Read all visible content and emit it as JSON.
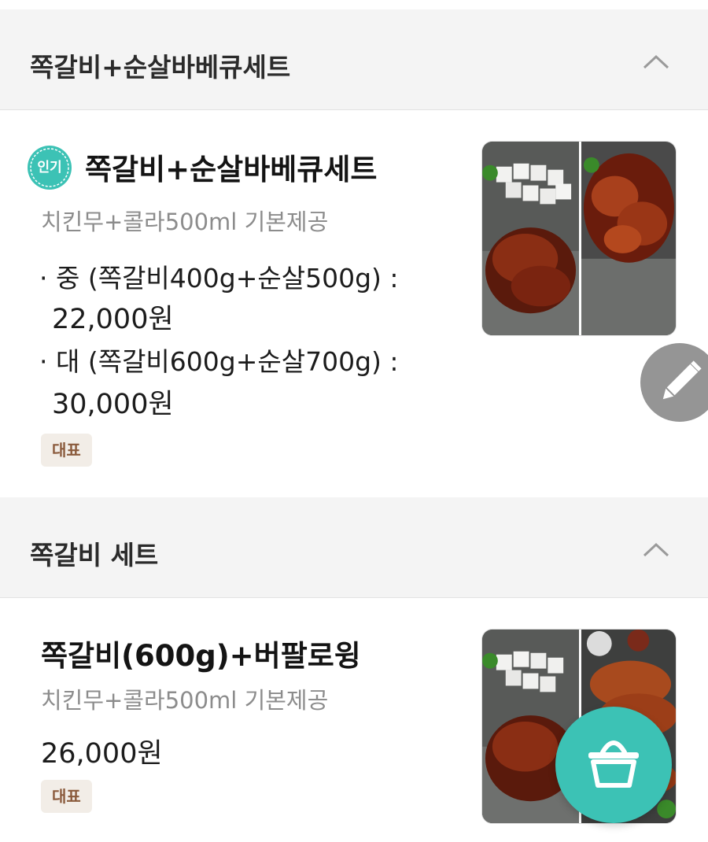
{
  "sections": [
    {
      "title": "쪽갈비+순살바베큐세트",
      "item": {
        "badge": "인기",
        "name": "쪽갈비+순살바베큐세트",
        "desc": "치킨무+콜라500ml 기본제공",
        "options": [
          {
            "label": "· 중 (쪽갈비400g+순살500g) :",
            "price": "22,000원"
          },
          {
            "label": "· 대 (쪽갈비600g+순살700g) :",
            "price": "30,000원"
          }
        ],
        "tag": "대표"
      }
    },
    {
      "title": "쪽갈비 세트",
      "item": {
        "name": "쪽갈비(600g)+버팔로윙",
        "desc": "치킨무+콜라500ml 기본제공",
        "price": "26,000원",
        "tag": "대표"
      }
    }
  ],
  "icons": {
    "collapse": "chevron-up-icon",
    "edit": "pencil-icon",
    "cart": "basket-icon"
  },
  "colors": {
    "badge": "#3cc2b5",
    "cart_fab": "#3cc2b5",
    "edit_fab": "#8d8d8d",
    "tag_bg": "#f2ede7",
    "tag_text": "#8a5a3c"
  }
}
